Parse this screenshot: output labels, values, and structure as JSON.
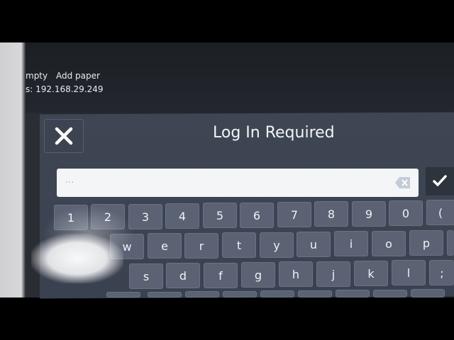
{
  "status": {
    "line1_a": "mpty",
    "line1_b": "Add paper",
    "line2": "s: 192.168.29.249"
  },
  "dialog": {
    "title": "Log In Required",
    "password_value": "···"
  },
  "keyboard": {
    "row1": [
      "1",
      "2",
      "3",
      "4",
      "5",
      "6",
      "7",
      "8",
      "9",
      "0",
      "("
    ],
    "row2": [
      "w",
      "e",
      "r",
      "t",
      "y",
      "u",
      "i",
      "o",
      "p"
    ],
    "row3": [
      "s",
      "d",
      "f",
      "g",
      "h",
      "j",
      "k",
      "l",
      ";"
    ]
  },
  "icons": {
    "close": "close-icon",
    "backspace": "backspace-icon",
    "confirm": "checkmark-icon"
  },
  "colors": {
    "dialog_bg": "#3f4653",
    "key_bg": "#5a6273",
    "input_bg": "#f4f5f7"
  }
}
